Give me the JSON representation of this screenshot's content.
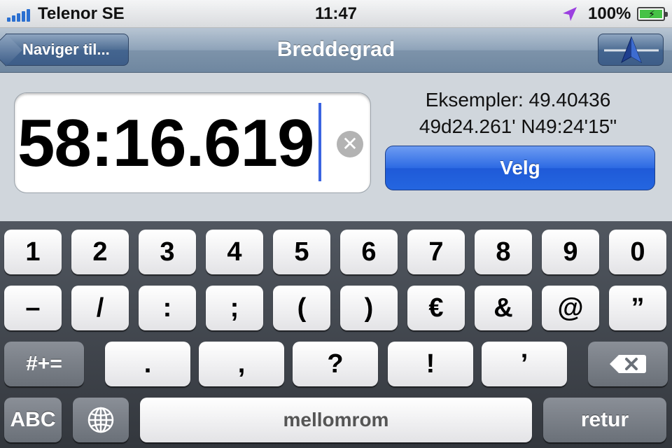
{
  "status_bar": {
    "carrier": "Telenor SE",
    "time": "11:47",
    "battery_percent": "100%",
    "signal_bars": 5,
    "location_icon": "location-arrow-icon",
    "battery_icon": "battery-charging-icon"
  },
  "nav": {
    "back_label": "Naviger til...",
    "title": "Breddegrad",
    "right_icon": "compass-arrow-icon"
  },
  "input": {
    "value": "58:16.619",
    "clear_icon": "clear-icon"
  },
  "examples": {
    "line1": "Eksempler: 49.40436",
    "line2": "49d24.261'   N49:24'15\""
  },
  "velg_label": "Velg",
  "keyboard": {
    "row1": [
      "1",
      "2",
      "3",
      "4",
      "5",
      "6",
      "7",
      "8",
      "9",
      "0"
    ],
    "row2": [
      "–",
      "/",
      ":",
      ";",
      "(",
      ")",
      "€",
      "&",
      "@",
      "”"
    ],
    "row3": {
      "shift_label": "#+=",
      "keys": [
        ".",
        ",",
        "?",
        "!",
        "’"
      ],
      "delete_icon": "backspace-icon"
    },
    "row4": {
      "abc_label": "ABC",
      "globe_icon": "globe-icon",
      "space_label": "mellomrom",
      "return_label": "retur"
    }
  },
  "colors": {
    "accent_blue": "#2466e0",
    "caret": "#3b64e0",
    "nav_bar": "#8ea3b9",
    "location_arrow": "#9b3fe0"
  }
}
